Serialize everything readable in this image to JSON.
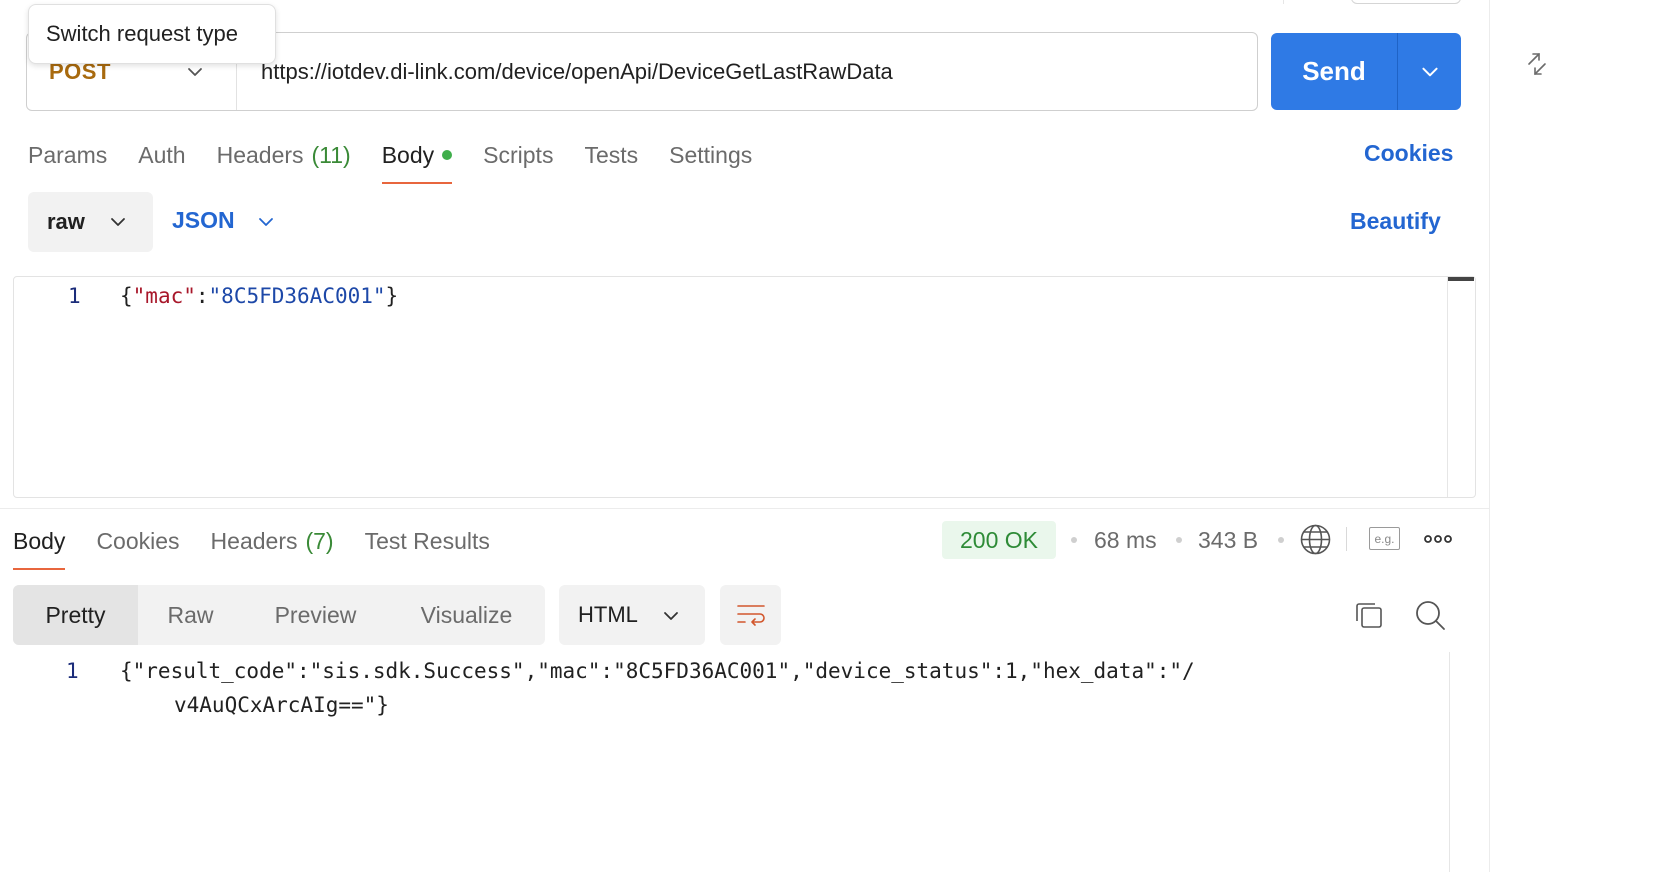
{
  "tooltip": {
    "text": "Switch request type"
  },
  "request": {
    "method": "POST",
    "url": "https://iotdev.di-link.com/device/openApi/DeviceGetLastRawData",
    "send_label": "Send"
  },
  "request_tabs": {
    "params": "Params",
    "auth": "Auth",
    "headers": "Headers",
    "headers_count": "(11)",
    "body": "Body",
    "scripts": "Scripts",
    "tests": "Tests",
    "settings": "Settings",
    "cookies": "Cookies"
  },
  "body_options": {
    "mode": "raw",
    "language": "JSON",
    "beautify": "Beautify"
  },
  "request_body": {
    "line_number": "1",
    "open_brace": "{",
    "key": "\"mac\"",
    "colon": ":",
    "value": "\"8C5FD36AC001\"",
    "close_brace": "}"
  },
  "response_tabs": {
    "body": "Body",
    "cookies": "Cookies",
    "headers": "Headers",
    "headers_count": "(7)",
    "test_results": "Test Results"
  },
  "response_meta": {
    "status": "200 OK",
    "time": "68 ms",
    "size": "343 B",
    "example_label": "e.g."
  },
  "response_view": {
    "modes": [
      "Pretty",
      "Raw",
      "Preview",
      "Visualize"
    ],
    "format": "HTML"
  },
  "response_body": {
    "line_number": "1",
    "line1": "{\"result_code\":\"sis.sdk.Success\",\"mac\":\"8C5FD36AC001\",\"device_status\":1,\"hex_data\":\"/",
    "line2": "v4AuQCxArcAIg==\"}"
  },
  "colors": {
    "accent": "#2f7ae5",
    "link": "#2366d1",
    "method": "#a86a0e",
    "tab_underline": "#e8663d",
    "status_ok": "#2e8b37"
  },
  "icons": [
    "chevron-down-icon",
    "collapse-icon",
    "globe-icon",
    "more-icon",
    "wrap-lines-icon",
    "copy-icon",
    "search-icon"
  ]
}
